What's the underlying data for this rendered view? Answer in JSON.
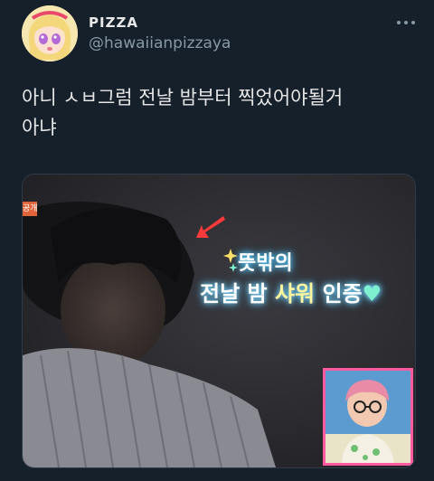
{
  "user": {
    "display_name": "PIZZA",
    "handle": "@hawaiianpizzaya"
  },
  "tweet": {
    "text_line1": "아니 ㅅㅂ그럼 전날 밤부터 찍었어야될거",
    "text_line2": "아냐"
  },
  "media": {
    "tag_text": "공개",
    "caption_line1": "뜻밖의",
    "caption_line2_part1": "전날 밤",
    "caption_line2_accent": "샤워",
    "caption_line2_part2": " 인증",
    "heart_glyph": "♥"
  },
  "colors": {
    "background": "#15202b",
    "handle": "#8899a6",
    "caption_glow": "#4fc3f7",
    "inset_border": "#ff5aa0"
  }
}
